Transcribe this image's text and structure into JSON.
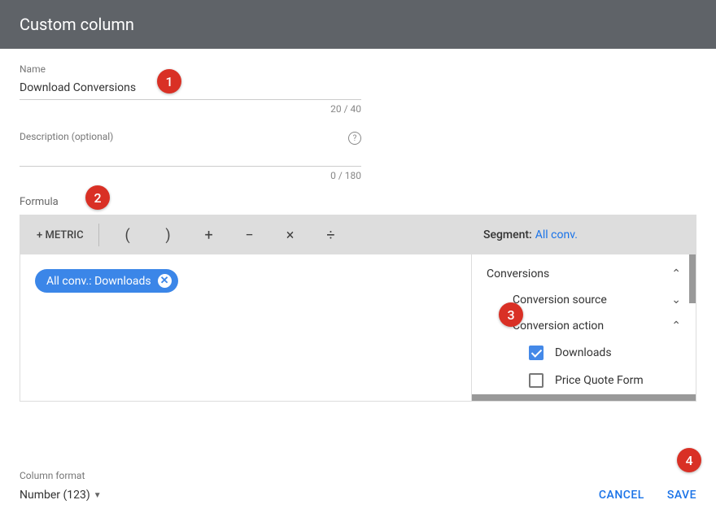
{
  "header": {
    "title": "Custom column"
  },
  "name_field": {
    "label": "Name",
    "value": "Download Conversions",
    "counter": "20 / 40"
  },
  "desc_field": {
    "label": "Description (optional)",
    "value": "",
    "counter": "0 / 180"
  },
  "formula": {
    "label": "Formula",
    "add_metric": "+ METRIC",
    "op_open": "(",
    "op_close": ")",
    "op_plus": "+",
    "op_minus": "−",
    "op_times": "×",
    "op_div": "÷",
    "chip_text": "All conv.: Downloads"
  },
  "segment": {
    "label": "Segment:",
    "value": "All conv.",
    "tree": {
      "root": "Conversions",
      "source": "Conversion source",
      "action": "Conversion action",
      "downloads": "Downloads",
      "price_quote": "Price Quote Form"
    }
  },
  "column_format": {
    "label": "Column format",
    "value": "Number (123)"
  },
  "actions": {
    "cancel": "CANCEL",
    "save": "SAVE"
  },
  "badges": {
    "b1": "1",
    "b2": "2",
    "b3": "3",
    "b4": "4"
  }
}
